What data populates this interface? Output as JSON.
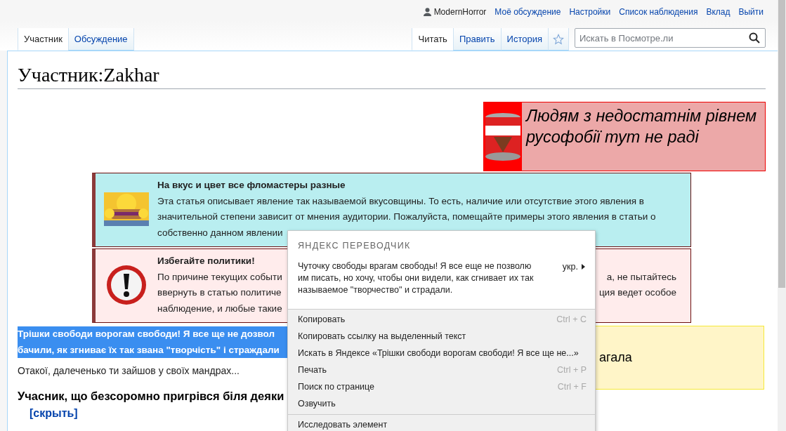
{
  "user_links": [
    {
      "text": "ModernHorror",
      "kind": "user"
    },
    {
      "text": "Моё обсуждение",
      "kind": "link"
    },
    {
      "text": "Настройки",
      "kind": "link"
    },
    {
      "text": "Список наблюдения",
      "kind": "link"
    },
    {
      "text": "Вклад",
      "kind": "link"
    },
    {
      "text": "Выйти",
      "kind": "link"
    }
  ],
  "namespace_tabs": [
    {
      "label": "Участник",
      "selected": true
    },
    {
      "label": "Обсуждение",
      "selected": false
    }
  ],
  "view_tabs": [
    {
      "label": "Читать",
      "selected": true
    },
    {
      "label": "Править",
      "selected": false
    },
    {
      "label": "История",
      "selected": false
    }
  ],
  "watch": {
    "watched": false
  },
  "search": {
    "placeholder": "Искать в Посмотре.ли"
  },
  "page_title": "Участник:Zakhar",
  "banner": {
    "text": "Людям з недостатнім рівнем русофобії тут не раді"
  },
  "notices": [
    {
      "kind": "cartoon",
      "color": "#b9eef0",
      "title": "На вкус и цвет все фломастеры разные",
      "lines": [
        {
          "left": "Эта статья описывает явление так называемой вкусовщины. То есть, наличие или отсутствие этого явления в"
        },
        {
          "left": "значительной степени зависит от мнения аудитории. Пожалуйста, помещайте примеры этого явления в статьи о"
        },
        {
          "left": "собственно данном явлении"
        }
      ]
    },
    {
      "kind": "warning",
      "color": "#ffecec",
      "title": "Избегайте политики!",
      "lines": [
        {
          "left": "По причине текущих событи",
          "right": "а, не пытайтесь"
        },
        {
          "left": "ввернуть в статью политиче",
          "right": "ция ведет особое"
        },
        {
          "left": "наблюдение, и любые такие"
        }
      ]
    }
  ],
  "selected_text": [
    "Трішки свободи ворогам свободи! Я все ще не дозвол",
    "бачили, як згниває їх так звана \"творчість\" і страждали"
  ],
  "paragraph": "Отакої, далеченько ти зайшов у своїх мандрах...",
  "section": {
    "heading": "Учасник, що безсоромно пригрівся біля деяки",
    "toggle": "[скрыть]"
  },
  "side_box": {
    "text": "агала"
  },
  "context_menu": {
    "title": "ЯНДЕКС ПЕРЕВОДЧИК",
    "translation": "Чуточку свободы врагам свободы! Я все еще не позволю им писать, но хочу, чтобы они видели, как сгнивает их так называемое \"творчество\" и страдали.",
    "language": "укр.",
    "groups": [
      [
        {
          "label": "Копировать",
          "shortcut": "Ctrl + C"
        },
        {
          "label": "Копировать ссылку на выделенный текст"
        },
        {
          "label": "Искать в Яндексе «Трішки свободи ворогам свободи! Я все ще не...»"
        },
        {
          "label": "Печать",
          "shortcut": "Ctrl + P"
        },
        {
          "label": "Поиск по странице",
          "shortcut": "Ctrl + F"
        },
        {
          "label": "Озвучить"
        }
      ],
      [
        {
          "label": "Исследовать элемент"
        }
      ]
    ]
  }
}
